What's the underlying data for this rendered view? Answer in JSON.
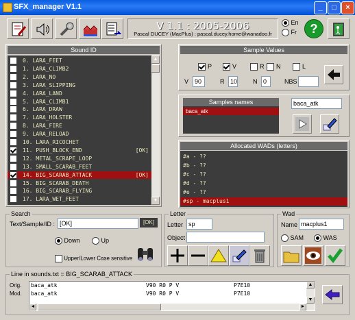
{
  "window": {
    "title": "SFX_manager V1.1",
    "min": "_",
    "max": "□",
    "close": "×"
  },
  "header": {
    "version_line": "V 1.1 : 2005-2006",
    "author_line": "Pascal DUCEY (MacPlus) : pascal.ducey.home@wanadoo.fr",
    "lang_en": "En",
    "lang_fr": "Fr",
    "help_symbol": "?"
  },
  "sound_list": {
    "title": "Sound ID",
    "items": [
      {
        "text": "0. LARA_FEET",
        "checked": false,
        "selected": false
      },
      {
        "text": "1. LARA_CLIMB2",
        "checked": false,
        "selected": false
      },
      {
        "text": "2. LARA_NO",
        "checked": false,
        "selected": false
      },
      {
        "text": "3. LARA_SLIPPING",
        "checked": false,
        "selected": false
      },
      {
        "text": "4. LARA_LAND",
        "checked": false,
        "selected": false
      },
      {
        "text": "5. LARA_CLIMB1",
        "checked": false,
        "selected": false
      },
      {
        "text": "6. LARA_DRAW",
        "checked": false,
        "selected": false
      },
      {
        "text": "7. LARA_HOLSTER",
        "checked": false,
        "selected": false
      },
      {
        "text": "8. LARA_FIRE",
        "checked": false,
        "selected": false
      },
      {
        "text": "9. LARA_RELOAD",
        "checked": false,
        "selected": false
      },
      {
        "text": "10. LARA_RICOCHET",
        "checked": false,
        "selected": false
      },
      {
        "text": "11. PUSH_BLOCK_END",
        "checked": true,
        "selected": false,
        "tag": "[OK]"
      },
      {
        "text": "12. METAL_SCRAPE_LOOP",
        "checked": false,
        "selected": false
      },
      {
        "text": "13. SMALL_SCARAB_FEET",
        "checked": false,
        "selected": false
      },
      {
        "text": "14. BIG_SCARAB_ATTACK",
        "checked": true,
        "selected": true,
        "tag": "[OK]"
      },
      {
        "text": "15. BIG_SCARAB_DEATH",
        "checked": false,
        "selected": false
      },
      {
        "text": "16. BIG_SCARAB_FLYING",
        "checked": false,
        "selected": false
      },
      {
        "text": "17. LARA_WET_FEET",
        "checked": false,
        "selected": false
      }
    ]
  },
  "sample_values": {
    "title": "Sample Values",
    "flags": [
      {
        "label": "P",
        "checked": true
      },
      {
        "label": "V",
        "checked": true
      },
      {
        "label": "R",
        "checked": false
      },
      {
        "label": "N",
        "checked": false
      },
      {
        "label": "L",
        "checked": false
      }
    ],
    "fields": [
      {
        "label": "V",
        "value": "90"
      },
      {
        "label": "R",
        "value": "10"
      },
      {
        "label": "N",
        "value": "0"
      },
      {
        "label": "NBS",
        "value": ""
      }
    ]
  },
  "samples_names": {
    "title": "Samples names",
    "items": [
      "baca_atk"
    ],
    "name_field": "baca_atk"
  },
  "wads": {
    "title": "Allocated WADs (letters)",
    "items": [
      {
        "text": "#a - ??",
        "selected": false
      },
      {
        "text": "#b - ??",
        "selected": false
      },
      {
        "text": "#c - ??",
        "selected": false
      },
      {
        "text": "#d - ??",
        "selected": false
      },
      {
        "text": "#e - ??",
        "selected": false
      },
      {
        "text": "#sp - macplus1",
        "selected": true
      }
    ]
  },
  "search": {
    "title": "Search",
    "label": "Text/Sample/ID :",
    "value": "[OK]",
    "tag": "[OK]",
    "down": "Down",
    "up": "Up",
    "case_label": "Upper/Lower Case sensitive"
  },
  "letter": {
    "title": "Letter",
    "letter_label": "Letter",
    "letter_value": "sp",
    "object_label": "Object",
    "object_value": ""
  },
  "wad": {
    "title": "Wad",
    "name_label": "Name",
    "name_value": "macplus1",
    "opt_sam": "SAM",
    "opt_was": "WAS"
  },
  "lines": {
    "title": "Line in sounds.txt = BIG_SCARAB_ATTACK",
    "orig_label": "Orig.",
    "mod_label": "Mod.",
    "orig_text": "baca_atk",
    "orig_vals": "V90 R0   P V",
    "orig_right": "P7E10",
    "mod_text": "baca_atk",
    "mod_vals": "V90 R0   P V",
    "mod_right": "P7E10"
  },
  "colors": {
    "selection": "#a01010",
    "titlebar": "#0a5fe0",
    "panel_dark": "#3c3c3c",
    "text_green": "#e8e8c0"
  }
}
